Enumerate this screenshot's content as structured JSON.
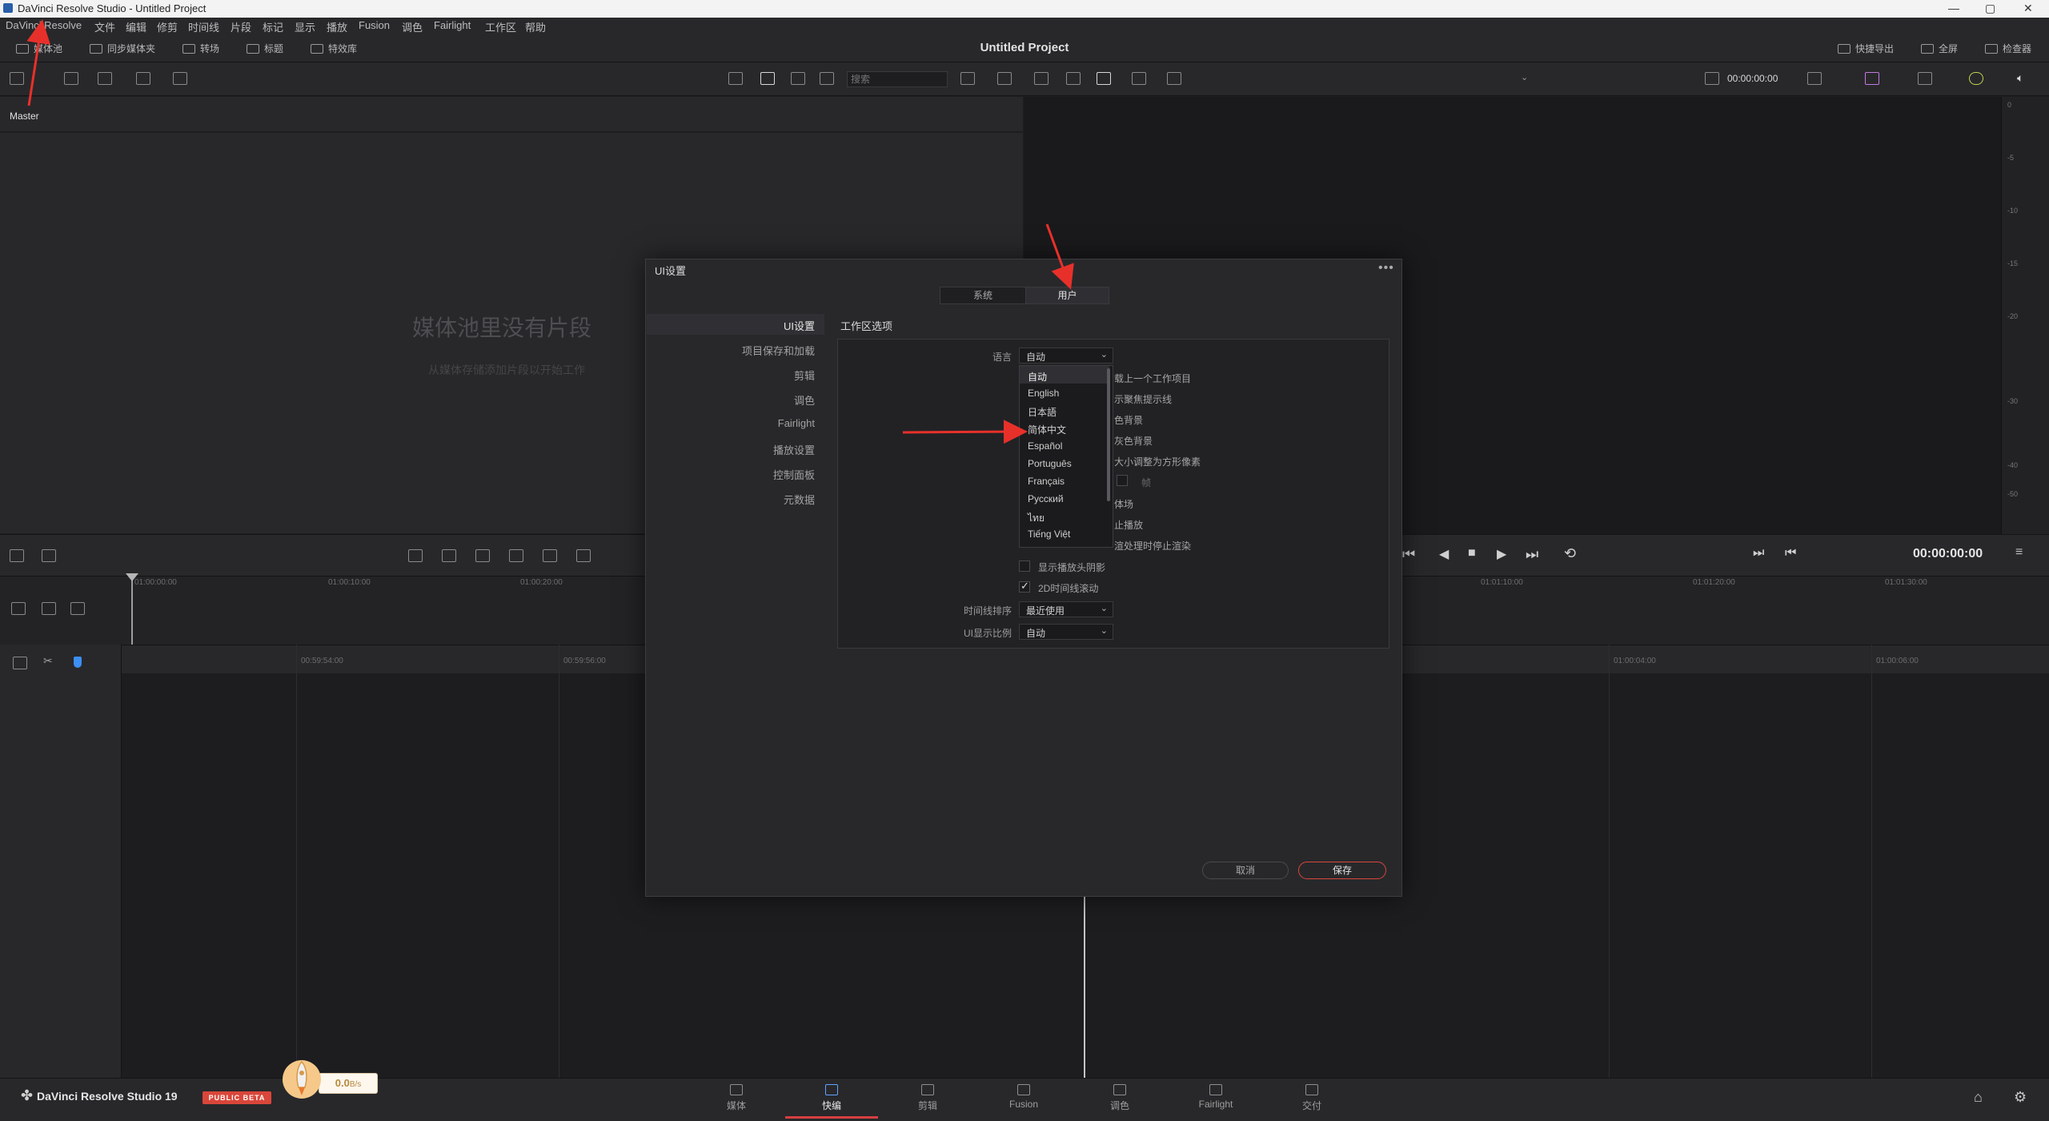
{
  "window": {
    "title": "DaVinci Resolve Studio - Untitled Project",
    "controls": [
      "—",
      "▢",
      "✕"
    ]
  },
  "menubar": [
    "DaVinci Resolve",
    "文件",
    "编辑",
    "修剪",
    "时间线",
    "片段",
    "标记",
    "显示",
    "播放",
    "Fusion",
    "调色",
    "Fairlight",
    "工作区",
    "帮助"
  ],
  "pagebar": {
    "left_buttons": [
      "媒体池",
      "同步媒体夹",
      "转场",
      "标题",
      "特效库"
    ],
    "project_title": "Untitled Project",
    "right_buttons": [
      "快捷导出",
      "全屏",
      "检查器"
    ]
  },
  "toolbar2": {
    "search_placeholder": "搜索",
    "viewer_timecode": "00:00:00:00"
  },
  "media_pool": {
    "bin_label": "Master",
    "empty_title": "媒体池里没有片段",
    "empty_subtitle": "从媒体存储添加片段以开始工作"
  },
  "meter": {
    "ticks": [
      "0",
      "-5",
      "-10",
      "-15",
      "-20",
      "-30",
      "-40",
      "-50"
    ]
  },
  "transport": {
    "timecode": "00:00:00:00"
  },
  "timeline_upper": {
    "ruler": [
      "01:00:00:00",
      "01:00:10:00",
      "01:00:20:00",
      "01:01:10:00",
      "01:01:20:00",
      "01:01:30:00"
    ]
  },
  "timeline_lower": {
    "ruler": [
      "00:59:54:00",
      "00:59:56:00",
      "01:00:04:00",
      "01:00:06:00"
    ]
  },
  "dialog": {
    "title": "UI设置",
    "more": "•••",
    "segments": [
      "系统",
      "用户"
    ],
    "active_segment": "用户",
    "sidebar": [
      "UI设置",
      "项目保存和加载",
      "剪辑",
      "调色",
      "Fairlight",
      "播放设置",
      "控制面板",
      "元数据"
    ],
    "active_sidebar": "UI设置",
    "section_title": "工作区选项",
    "language_label": "语言",
    "language_value": "自动",
    "options": [
      {
        "label": "载上一个工作项目",
        "checked": false
      },
      {
        "label": "示聚焦提示线",
        "checked": false
      },
      {
        "label": "色背景",
        "checked": false
      },
      {
        "label": "灰色背景",
        "checked": false
      },
      {
        "label": "大小调整为方形像素",
        "checked": false
      },
      {
        "label": "帧",
        "checked": false
      },
      {
        "label": "体场",
        "checked": false
      },
      {
        "label": "止播放",
        "checked": false
      },
      {
        "label": "渲处理时停止渲染",
        "checked": false
      },
      {
        "label": "显示播放头阴影",
        "checked": false
      },
      {
        "label": "2D时间线滚动",
        "checked": true
      }
    ],
    "timeline_sort_label": "时间线排序",
    "timeline_sort_value": "最近使用",
    "ui_scale_label": "UI显示比例",
    "ui_scale_value": "自动",
    "cancel": "取消",
    "save": "保存"
  },
  "language_dropdown": [
    "自动",
    "English",
    "日本語",
    "简体中文",
    "Español",
    "Português",
    "Français",
    "Русский",
    "ไทย",
    "Tiếng Việt"
  ],
  "bottombar": {
    "brand": "DaVinci Resolve Studio 19",
    "beta": "PUBLIC BETA",
    "speed": "0.0",
    "speed_unit": "B/s",
    "tabs": [
      "媒体",
      "快编",
      "剪辑",
      "Fusion",
      "调色",
      "Fairlight",
      "交付"
    ],
    "active_tab": "快编"
  },
  "colors": {
    "accent_red": "#d9463a",
    "annotation_red": "#e8302a",
    "active_blue": "#5fa3ff"
  }
}
